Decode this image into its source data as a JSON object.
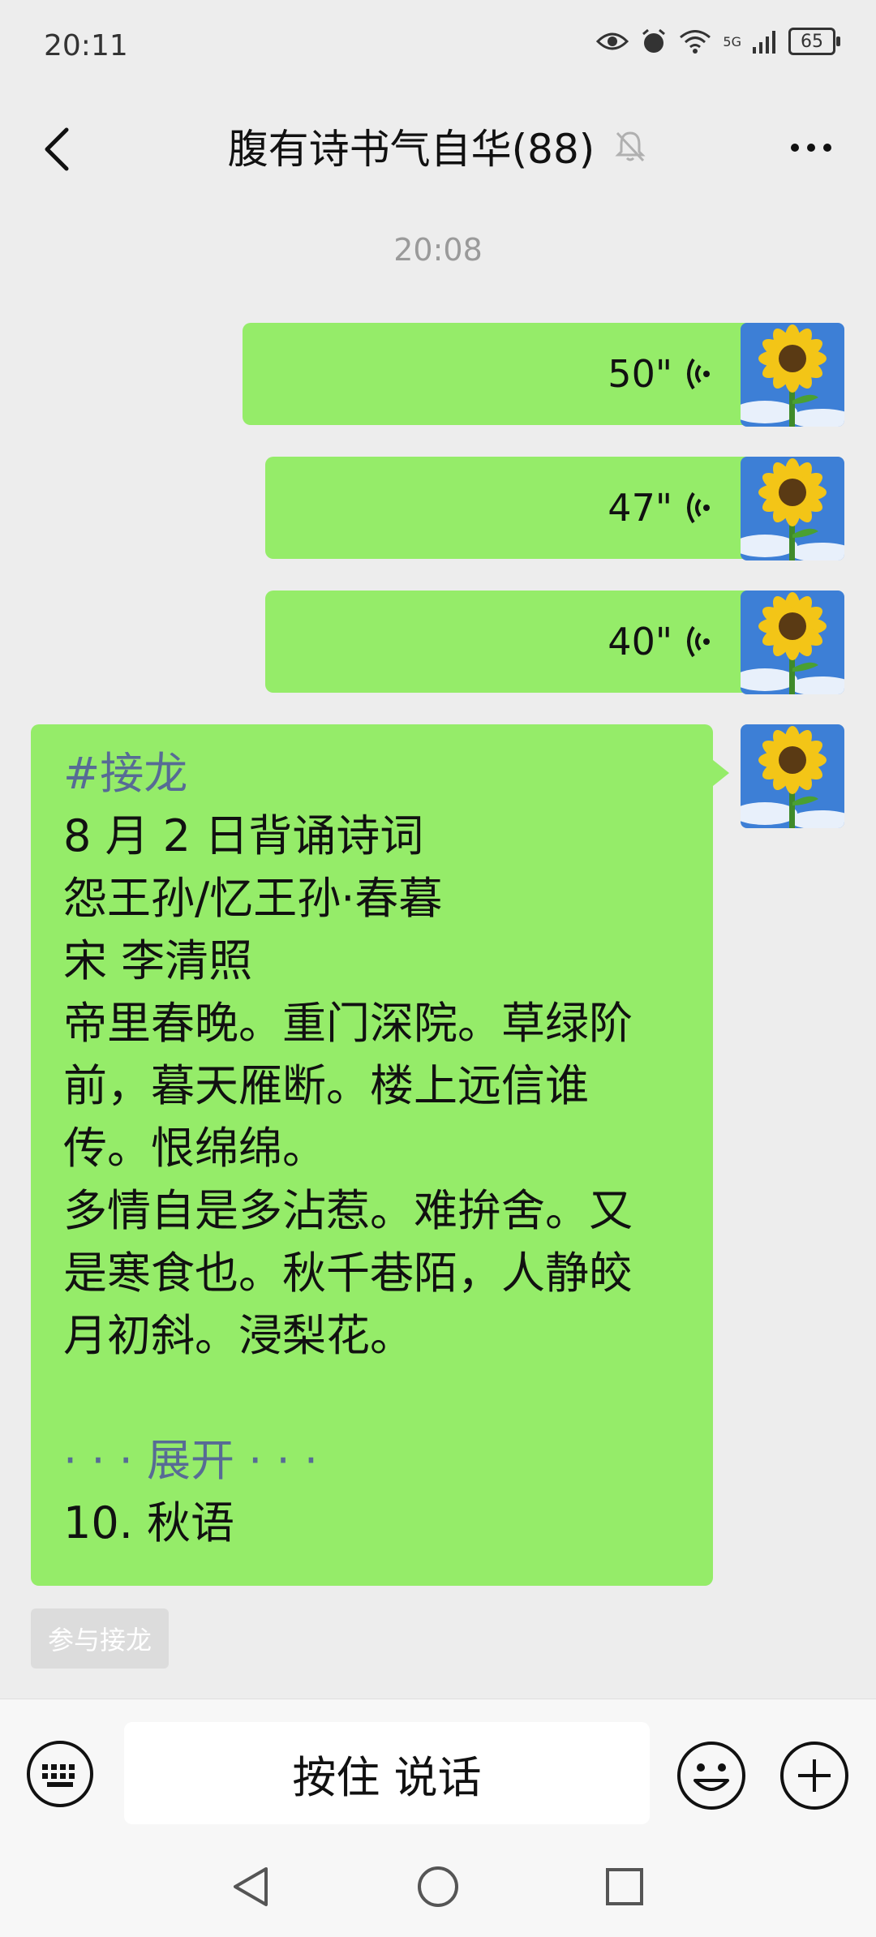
{
  "status_bar": {
    "time": "20:11",
    "network": "5G",
    "battery": "65"
  },
  "header": {
    "title": "腹有诗书气自华(88)"
  },
  "chat": {
    "timestamp": "20:08",
    "voice_messages": [
      {
        "duration": "50\""
      },
      {
        "duration": "47\""
      },
      {
        "duration": "40\""
      }
    ],
    "text_message": {
      "tag": "#接龙",
      "lines": [
        "8 月 2 日背诵诗词",
        "怨王孙/忆王孙·春暮",
        "宋  李清照",
        "帝里春晚。重门深院。草绿阶",
        "前，暮天雁断。楼上远信谁",
        "传。恨绵绵。",
        "多情自是多沾惹。难拚舍。又",
        "是寒食也。秋千巷陌，人静皎",
        "月初斜。浸梨花。"
      ],
      "expand_label": "· · · 展开 · · ·",
      "last_line": "10. 秋语"
    },
    "join_button": "参与接龙"
  },
  "input_bar": {
    "hold_to_talk": "按住 说话"
  },
  "colors": {
    "bubble": "#95ec69",
    "link": "#576b95",
    "background": "#ededed"
  }
}
